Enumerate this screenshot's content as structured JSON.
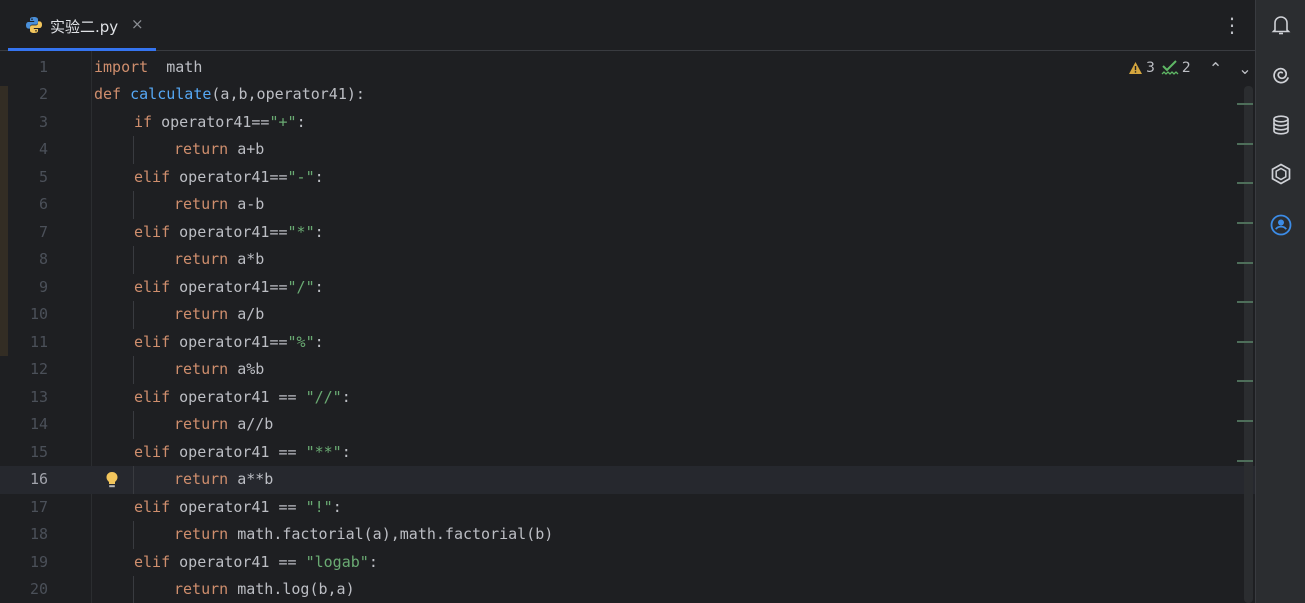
{
  "tab": {
    "filename": "实验二.py",
    "close_glyph": "×",
    "menu_glyph": "⋮"
  },
  "inspections": {
    "warnings": "3",
    "typos": "2",
    "up_glyph": "⌃",
    "down_glyph": "⌄"
  },
  "editor": {
    "current_line": 16,
    "lines": [
      {
        "num": "1",
        "indent": 0,
        "tokens": [
          [
            "kw",
            "import"
          ],
          [
            "",
            "  math"
          ]
        ]
      },
      {
        "num": "2",
        "indent": 0,
        "tokens": [
          [
            "kw",
            "def"
          ],
          [
            "fn",
            " calculate"
          ],
          [
            "",
            "(a,b,operator41):"
          ]
        ]
      },
      {
        "num": "3",
        "indent": 1,
        "tokens": [
          [
            "kw",
            "if"
          ],
          [
            "",
            " operator41=="
          ],
          [
            "str",
            "\"+\""
          ],
          [
            "",
            ":"
          ]
        ]
      },
      {
        "num": "4",
        "indent": 2,
        "tokens": [
          [
            "kw",
            "return"
          ],
          [
            "",
            " a+b"
          ]
        ]
      },
      {
        "num": "5",
        "indent": 1,
        "tokens": [
          [
            "kw",
            "elif"
          ],
          [
            "",
            " operator41=="
          ],
          [
            "str",
            "\"-\""
          ],
          [
            "",
            ":"
          ]
        ]
      },
      {
        "num": "6",
        "indent": 2,
        "tokens": [
          [
            "kw",
            "return"
          ],
          [
            "",
            " a-b"
          ]
        ]
      },
      {
        "num": "7",
        "indent": 1,
        "tokens": [
          [
            "kw",
            "elif"
          ],
          [
            "",
            " operator41=="
          ],
          [
            "str",
            "\"*\""
          ],
          [
            "",
            ":"
          ]
        ]
      },
      {
        "num": "8",
        "indent": 2,
        "tokens": [
          [
            "kw",
            "return"
          ],
          [
            "",
            " a*b"
          ]
        ]
      },
      {
        "num": "9",
        "indent": 1,
        "tokens": [
          [
            "kw",
            "elif"
          ],
          [
            "",
            " operator41=="
          ],
          [
            "str",
            "\"/\""
          ],
          [
            "",
            ":"
          ]
        ]
      },
      {
        "num": "10",
        "indent": 2,
        "tokens": [
          [
            "kw",
            "return"
          ],
          [
            "",
            " a/b"
          ]
        ]
      },
      {
        "num": "11",
        "indent": 1,
        "tokens": [
          [
            "kw",
            "elif"
          ],
          [
            "",
            " operator41=="
          ],
          [
            "str",
            "\"%\""
          ],
          [
            "",
            ":"
          ]
        ]
      },
      {
        "num": "12",
        "indent": 2,
        "tokens": [
          [
            "kw",
            "return"
          ],
          [
            "",
            " a%b"
          ]
        ]
      },
      {
        "num": "13",
        "indent": 1,
        "tokens": [
          [
            "kw",
            "elif"
          ],
          [
            "",
            " operator41 == "
          ],
          [
            "str",
            "\"//\""
          ],
          [
            "",
            ":"
          ]
        ]
      },
      {
        "num": "14",
        "indent": 2,
        "tokens": [
          [
            "kw",
            "return"
          ],
          [
            "",
            " a//b"
          ]
        ]
      },
      {
        "num": "15",
        "indent": 1,
        "tokens": [
          [
            "kw",
            "elif"
          ],
          [
            "",
            " operator41 == "
          ],
          [
            "str",
            "\"**\""
          ],
          [
            "",
            ":"
          ]
        ]
      },
      {
        "num": "16",
        "indent": 2,
        "tokens": [
          [
            "kw",
            "return"
          ],
          [
            "",
            " a**b"
          ]
        ]
      },
      {
        "num": "17",
        "indent": 1,
        "tokens": [
          [
            "kw",
            "elif"
          ],
          [
            "",
            " operator41 == "
          ],
          [
            "str",
            "\"!\""
          ],
          [
            "",
            ":"
          ]
        ]
      },
      {
        "num": "18",
        "indent": 2,
        "tokens": [
          [
            "kw",
            "return"
          ],
          [
            "",
            " math.factorial(a),math.factorial(b)"
          ]
        ]
      },
      {
        "num": "19",
        "indent": 1,
        "tokens": [
          [
            "kw",
            "elif"
          ],
          [
            "",
            " operator41 == "
          ],
          [
            "str",
            "\"logab\""
          ],
          [
            "",
            ":"
          ]
        ]
      },
      {
        "num": "20",
        "indent": 2,
        "tokens": [
          [
            "kw",
            "return"
          ],
          [
            "",
            " math.log(b,a)"
          ]
        ]
      }
    ]
  },
  "colors": {
    "keyword": "#cf8e6d",
    "function": "#56a8f5",
    "string": "#6aab73",
    "accent": "#3574f0",
    "warning": "#f2c55c"
  },
  "icons": {
    "tab_file": "python-file-icon",
    "gutter": "lightbulb-icon",
    "right_toolbar": [
      "notifications-bell-icon",
      "ai-assistant-spiral-icon",
      "database-icon",
      "plugin-hexagon-icon",
      "account-icon"
    ]
  }
}
